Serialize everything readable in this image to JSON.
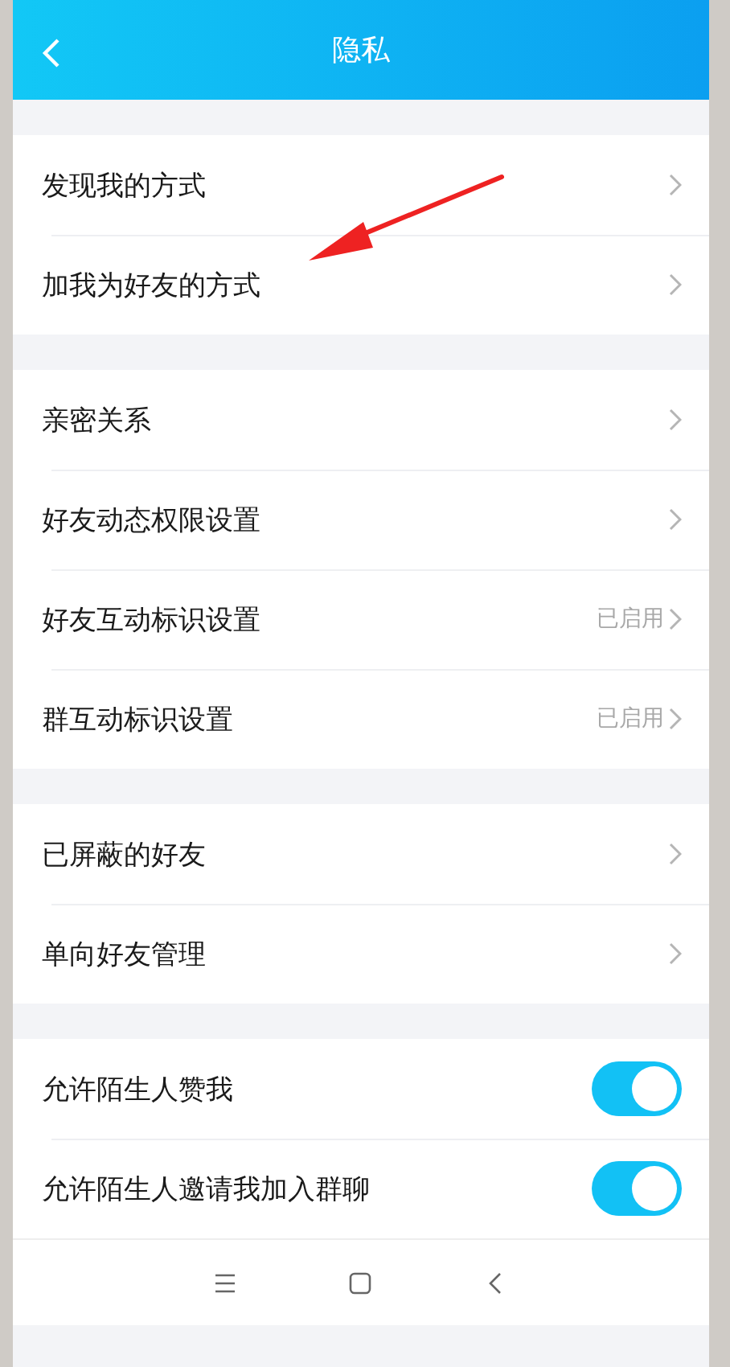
{
  "header": {
    "title": "隐私"
  },
  "sections": [
    {
      "items": [
        {
          "kind": "link",
          "label": "发现我的方式"
        },
        {
          "kind": "link",
          "label": "加我为好友的方式"
        }
      ]
    },
    {
      "items": [
        {
          "kind": "link",
          "label": "亲密关系"
        },
        {
          "kind": "link",
          "label": "好友动态权限设置"
        },
        {
          "kind": "link",
          "label": "好友互动标识设置",
          "value": "已启用"
        },
        {
          "kind": "link",
          "label": "群互动标识设置",
          "value": "已启用"
        }
      ]
    },
    {
      "items": [
        {
          "kind": "link",
          "label": "已屏蔽的好友"
        },
        {
          "kind": "link",
          "label": "单向好友管理"
        }
      ]
    },
    {
      "items": [
        {
          "kind": "toggle",
          "label": "允许陌生人赞我",
          "on": true
        },
        {
          "kind": "toggle",
          "label": "允许陌生人邀请我加入群聊",
          "on": true
        }
      ]
    }
  ]
}
